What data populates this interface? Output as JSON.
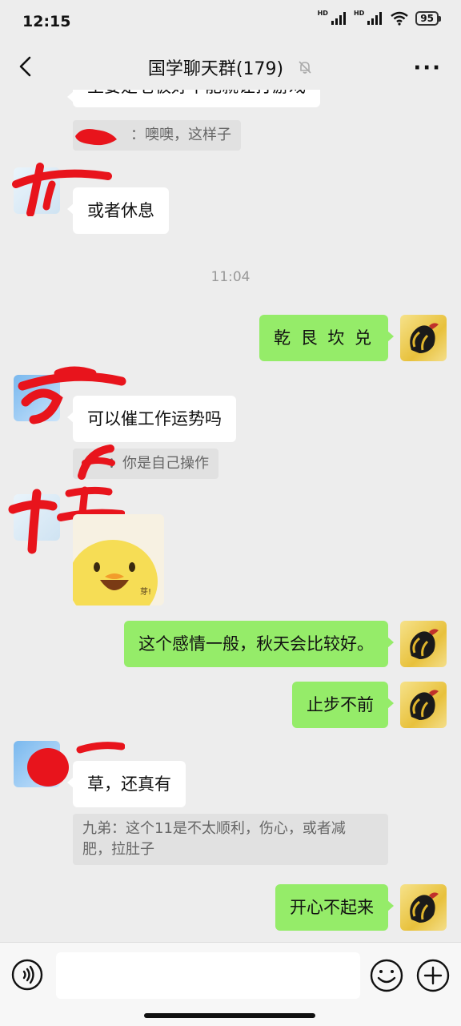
{
  "status_bar": {
    "time": "12:15",
    "battery": "95",
    "hd1": "HD",
    "hd2": "HD"
  },
  "header": {
    "title": "国学聊天群(179)"
  },
  "messages": {
    "partial_top": "主要是老板好不能就让打游戏",
    "quote1": "：噢噢，这样子",
    "m1": "或者休息",
    "timestamp": "11:04",
    "m2": "乾 艮 坎 兑",
    "m3": "可以催工作运势吗",
    "quote2": "：你是自己操作",
    "sticker_text": "芽!",
    "m4": "这个感情一般，秋天会比较好。",
    "m5": "止步不前",
    "m6": "草，还真有",
    "quote3_line1": "九弟：这个11是不太顺利，伤心，或者减",
    "quote3_line2": "肥，拉肚子",
    "m7": "开心不起来"
  },
  "colors": {
    "self_bubble": "#95ec69",
    "other_bubble": "#ffffff",
    "background": "#ededed",
    "redaction": "#e8141c"
  }
}
